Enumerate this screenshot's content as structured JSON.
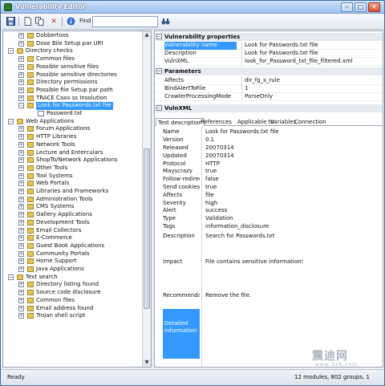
{
  "window": {
    "title": "Vulnerability Editor",
    "minimize": "‒",
    "maximize": "□",
    "close": "✕"
  },
  "toolbar": {
    "save_icon": "save-icon",
    "new_icon": "new-icon",
    "copy_icon": "copy-icon",
    "delete_icon": "delete-icon",
    "info_icon": "info-icon",
    "find_label": "Find",
    "find_value": "",
    "find_button_icon": "binoculars-icon"
  },
  "tree": {
    "items": [
      {
        "label": "Dobbertoos",
        "level": 1,
        "kind": "group",
        "expanded": false
      },
      {
        "label": "Dose Bile Setup par URI",
        "level": 1,
        "kind": "group",
        "expanded": false
      },
      {
        "label": "Directory checks",
        "level": 0,
        "kind": "folder",
        "expanded": true
      },
      {
        "label": "Common files",
        "level": 1,
        "kind": "group",
        "expanded": false
      },
      {
        "label": "Possible sensitive files",
        "level": 1,
        "kind": "group",
        "expanded": false
      },
      {
        "label": "Possible sensitive directories",
        "level": 1,
        "kind": "group",
        "expanded": false
      },
      {
        "label": "Directory permissions",
        "level": 1,
        "kind": "group",
        "expanded": false
      },
      {
        "label": "Possible file Setup par path",
        "level": 1,
        "kind": "group",
        "expanded": false
      },
      {
        "label": "TRACE Caxx ss Insolution",
        "level": 1,
        "kind": "group",
        "expanded": false
      },
      {
        "label": "Look for Passwords.txt file",
        "level": 1,
        "kind": "group",
        "expanded": true,
        "selected": true
      },
      {
        "label": "Password.txt",
        "level": 2,
        "kind": "file",
        "expanded": null
      },
      {
        "label": "Web Applications",
        "level": 0,
        "kind": "folder",
        "expanded": true
      },
      {
        "label": "Forum Applications",
        "level": 1,
        "kind": "group",
        "expanded": false
      },
      {
        "label": "HTTP Libraries",
        "level": 1,
        "kind": "group",
        "expanded": false
      },
      {
        "label": "Network Tools",
        "level": 1,
        "kind": "group",
        "expanded": false
      },
      {
        "label": "Lecture and Enterculars",
        "level": 1,
        "kind": "group",
        "expanded": false
      },
      {
        "label": "ShopTo/Network Applications",
        "level": 1,
        "kind": "group",
        "expanded": false
      },
      {
        "label": "Other Tools",
        "level": 1,
        "kind": "group",
        "expanded": false
      },
      {
        "label": "Tool Systems",
        "level": 1,
        "kind": "group",
        "expanded": false
      },
      {
        "label": "Web Portals",
        "level": 1,
        "kind": "group",
        "expanded": false
      },
      {
        "label": "Libraries and Frameworks",
        "level": 1,
        "kind": "group",
        "expanded": false
      },
      {
        "label": "Administration Tools",
        "level": 1,
        "kind": "group",
        "expanded": false
      },
      {
        "label": "CMS Systems",
        "level": 1,
        "kind": "group",
        "expanded": false
      },
      {
        "label": "Gallery Applications",
        "level": 1,
        "kind": "group",
        "expanded": false
      },
      {
        "label": "Development Tools",
        "level": 1,
        "kind": "group",
        "expanded": false
      },
      {
        "label": "Email Collectors",
        "level": 1,
        "kind": "group",
        "expanded": false
      },
      {
        "label": "E-Commerce",
        "level": 1,
        "kind": "group",
        "expanded": false
      },
      {
        "label": "Guest Book Applications",
        "level": 1,
        "kind": "group",
        "expanded": false
      },
      {
        "label": "Community Portals",
        "level": 1,
        "kind": "group",
        "expanded": false
      },
      {
        "label": "Home Support",
        "level": 1,
        "kind": "group",
        "expanded": false
      },
      {
        "label": "Java Applications",
        "level": 1,
        "kind": "group",
        "expanded": false
      },
      {
        "label": "Text search",
        "level": 0,
        "kind": "folder",
        "expanded": true
      },
      {
        "label": "Directory listing found",
        "level": 1,
        "kind": "group",
        "expanded": false
      },
      {
        "label": "Source code disclosure",
        "level": 1,
        "kind": "group",
        "expanded": false
      },
      {
        "label": "Common files",
        "level": 1,
        "kind": "group",
        "expanded": false
      },
      {
        "label": "Email address found",
        "level": 1,
        "kind": "group",
        "expanded": false
      },
      {
        "label": "Trojan shell script",
        "level": 1,
        "kind": "group",
        "expanded": false
      }
    ]
  },
  "properties": {
    "section1_title": "Vulnerability properties",
    "section1_rows": [
      {
        "key": "Vulnerability name",
        "value": "Look for Passwords.txt file",
        "selected": true
      },
      {
        "key": "Description",
        "value": "Look for Passwords.txt file"
      },
      {
        "key": "VulnXML",
        "value": "look_for_Password_txt_file_filtered.xml"
      }
    ],
    "section2_title": "Parameters",
    "section2_rows": [
      {
        "key": "Affects",
        "value": "dir_fg_s_rule"
      },
      {
        "key": "BindAlertToFile",
        "value": "1"
      },
      {
        "key": "CrawlerProcessingMode",
        "value": "ParseOnly"
      }
    ],
    "section3_title": "VulnXML"
  },
  "tabs": [
    "Test description",
    "References",
    "Applicable to",
    "Variables",
    "Connection"
  ],
  "detail": {
    "rows": [
      {
        "key": "Name",
        "value": "Look for Passwords.txt file"
      },
      {
        "key": "Version",
        "value": "0.1"
      },
      {
        "key": "Released",
        "value": "20070314"
      },
      {
        "key": "Updated",
        "value": "20070314"
      },
      {
        "key": "Protocol",
        "value": "HTTP"
      },
      {
        "key": "Mayscrazy",
        "value": "true"
      },
      {
        "key": "Follow-redirects",
        "value": "false"
      },
      {
        "key": "Send cookies",
        "value": "true"
      },
      {
        "key": "Affects",
        "value": "file"
      },
      {
        "key": "Severity",
        "value": "high"
      },
      {
        "key": "Alert",
        "value": "success"
      },
      {
        "key": "Type",
        "value": "Validation"
      },
      {
        "key": "Tags",
        "value": "information_disclosure"
      },
      {
        "key": "Description",
        "value": "Search for Passwords.txt"
      },
      {
        "key": "Impact",
        "value": "File contains sensitive information!"
      },
      {
        "key": "Recommendations",
        "value": "Remove the file."
      },
      {
        "key": "Detailed information",
        "value": "",
        "selected": true
      }
    ]
  },
  "status": {
    "left": "Ready",
    "right": "12 modules, 802 groups, 1"
  },
  "watermark": {
    "text": "震迪网",
    "sub": "www.3xb.com"
  }
}
